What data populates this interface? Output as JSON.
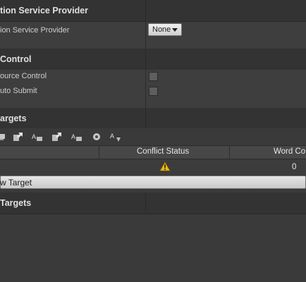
{
  "sections": {
    "service_provider": {
      "title": "tion Service Provider",
      "property_label": "ion Service Provider",
      "dropdown_value": "None"
    },
    "source_control": {
      "title": "Control",
      "use_source_control_label": "ource Control",
      "auto_submit_label": "uto Submit",
      "use_source_control_checked": false,
      "auto_submit_checked": false
    },
    "targets": {
      "title": "argets",
      "toolbar_icons": [
        "gather-icon",
        "import-icon",
        "export-icon",
        "import-text-icon",
        "export-text-icon",
        "compile-icon",
        "count-words-icon"
      ],
      "table_columns": [
        "Conflict Status",
        "Word Co"
      ],
      "rows": [
        {
          "conflict_status_icon": "warning-icon",
          "word_count": "0"
        }
      ],
      "new_target_label": "w Target"
    },
    "other_targets": {
      "title": "Targets"
    }
  }
}
